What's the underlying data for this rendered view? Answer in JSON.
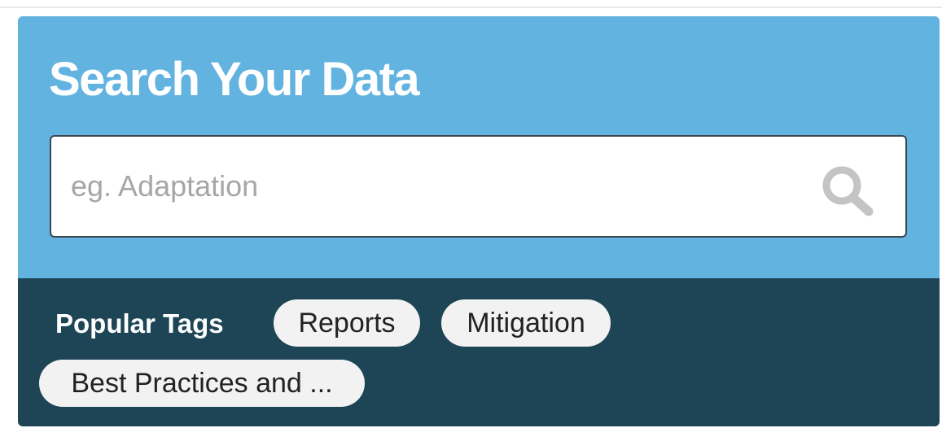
{
  "header": {
    "title": "Search Your Data"
  },
  "search": {
    "placeholder": "eg. Adaptation",
    "value": "",
    "icon": "search-icon"
  },
  "tags": {
    "label": "Popular Tags",
    "items": [
      {
        "label": "Reports"
      },
      {
        "label": "Mitigation"
      },
      {
        "label": "Best Practices and ..."
      }
    ]
  },
  "colors": {
    "search_panel_bg": "#63b3e1",
    "tags_panel_bg": "#1d4556",
    "pill_bg": "#f2f2f2",
    "icon_color": "#c4c4c4"
  }
}
